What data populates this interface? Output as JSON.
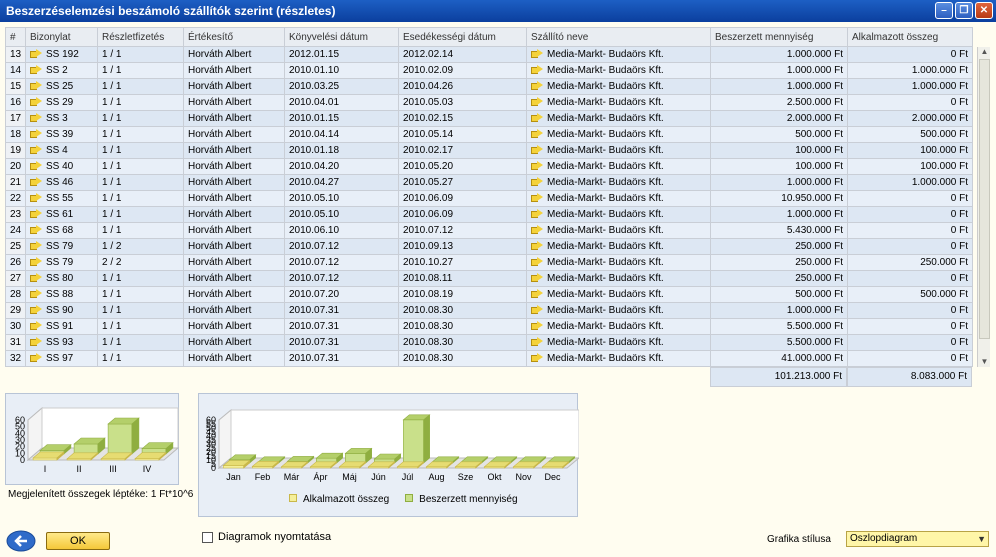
{
  "window": {
    "title": "Beszerzéselemzési beszámoló szállítók szerint (részletes)"
  },
  "columns": [
    "#",
    "Bizonylat",
    "Részletfizetés",
    "Értékesítő",
    "Könyvelési dátum",
    "Esedékességi dátum",
    "Szállító neve",
    "Beszerzett mennyiség",
    "Alkalmazott összeg"
  ],
  "rows": [
    [
      "13",
      "SS 192",
      "1 / 1",
      "Horváth Albert",
      "2012.01.15",
      "2012.02.14",
      "Media-Markt- Budaörs Kft.",
      "1.000.000 Ft",
      "0 Ft"
    ],
    [
      "14",
      "SS 2",
      "1 / 1",
      "Horváth Albert",
      "2010.01.10",
      "2010.02.09",
      "Media-Markt- Budaörs Kft.",
      "1.000.000 Ft",
      "1.000.000 Ft"
    ],
    [
      "15",
      "SS 25",
      "1 / 1",
      "Horváth Albert",
      "2010.03.25",
      "2010.04.26",
      "Media-Markt- Budaörs Kft.",
      "1.000.000 Ft",
      "1.000.000 Ft"
    ],
    [
      "16",
      "SS 29",
      "1 / 1",
      "Horváth Albert",
      "2010.04.01",
      "2010.05.03",
      "Media-Markt- Budaörs Kft.",
      "2.500.000 Ft",
      "0 Ft"
    ],
    [
      "17",
      "SS 3",
      "1 / 1",
      "Horváth Albert",
      "2010.01.15",
      "2010.02.15",
      "Media-Markt- Budaörs Kft.",
      "2.000.000 Ft",
      "2.000.000 Ft"
    ],
    [
      "18",
      "SS 39",
      "1 / 1",
      "Horváth Albert",
      "2010.04.14",
      "2010.05.14",
      "Media-Markt- Budaörs Kft.",
      "500.000 Ft",
      "500.000 Ft"
    ],
    [
      "19",
      "SS 4",
      "1 / 1",
      "Horváth Albert",
      "2010.01.18",
      "2010.02.17",
      "Media-Markt- Budaörs Kft.",
      "100.000 Ft",
      "100.000 Ft"
    ],
    [
      "20",
      "SS 40",
      "1 / 1",
      "Horváth Albert",
      "2010.04.20",
      "2010.05.20",
      "Media-Markt- Budaörs Kft.",
      "100.000 Ft",
      "100.000 Ft"
    ],
    [
      "21",
      "SS 46",
      "1 / 1",
      "Horváth Albert",
      "2010.04.27",
      "2010.05.27",
      "Media-Markt- Budaörs Kft.",
      "1.000.000 Ft",
      "1.000.000 Ft"
    ],
    [
      "22",
      "SS 55",
      "1 / 1",
      "Horváth Albert",
      "2010.05.10",
      "2010.06.09",
      "Media-Markt- Budaörs Kft.",
      "10.950.000 Ft",
      "0 Ft"
    ],
    [
      "23",
      "SS 61",
      "1 / 1",
      "Horváth Albert",
      "2010.05.10",
      "2010.06.09",
      "Media-Markt- Budaörs Kft.",
      "1.000.000 Ft",
      "0 Ft"
    ],
    [
      "24",
      "SS 68",
      "1 / 1",
      "Horváth Albert",
      "2010.06.10",
      "2010.07.12",
      "Media-Markt- Budaörs Kft.",
      "5.430.000 Ft",
      "0 Ft"
    ],
    [
      "25",
      "SS 79",
      "1 / 2",
      "Horváth Albert",
      "2010.07.12",
      "2010.09.13",
      "Media-Markt- Budaörs Kft.",
      "250.000 Ft",
      "0 Ft"
    ],
    [
      "26",
      "SS 79",
      "2 / 2",
      "Horváth Albert",
      "2010.07.12",
      "2010.10.27",
      "Media-Markt- Budaörs Kft.",
      "250.000 Ft",
      "250.000 Ft"
    ],
    [
      "27",
      "SS 80",
      "1 / 1",
      "Horváth Albert",
      "2010.07.12",
      "2010.08.11",
      "Media-Markt- Budaörs Kft.",
      "250.000 Ft",
      "0 Ft"
    ],
    [
      "28",
      "SS 88",
      "1 / 1",
      "Horváth Albert",
      "2010.07.20",
      "2010.08.19",
      "Media-Markt- Budaörs Kft.",
      "500.000 Ft",
      "500.000 Ft"
    ],
    [
      "29",
      "SS 90",
      "1 / 1",
      "Horváth Albert",
      "2010.07.31",
      "2010.08.30",
      "Media-Markt- Budaörs Kft.",
      "1.000.000 Ft",
      "0 Ft"
    ],
    [
      "30",
      "SS 91",
      "1 / 1",
      "Horváth Albert",
      "2010.07.31",
      "2010.08.30",
      "Media-Markt- Budaörs Kft.",
      "5.500.000 Ft",
      "0 Ft"
    ],
    [
      "31",
      "SS 93",
      "1 / 1",
      "Horváth Albert",
      "2010.07.31",
      "2010.08.30",
      "Media-Markt- Budaörs Kft.",
      "5.500.000 Ft",
      "0 Ft"
    ],
    [
      "32",
      "SS 97",
      "1 / 1",
      "Horváth Albert",
      "2010.07.31",
      "2010.08.30",
      "Media-Markt- Budaörs Kft.",
      "41.000.000 Ft",
      "0 Ft"
    ]
  ],
  "totals": {
    "quantity": "101.213.000 Ft",
    "applied": "8.083.000 Ft"
  },
  "scale_note": "Megjelenített összegek léptéke: 1 Ft*10^6",
  "buttons": {
    "ok": "OK"
  },
  "print_charts": {
    "label": "Diagramok nyomtatása",
    "checked": false
  },
  "chart_style": {
    "label": "Grafika stílusa",
    "value": "Oszlopdiagram"
  },
  "colors": {
    "applied": "#f5ef9a",
    "purchased": "#c9e08a"
  },
  "chart_data": [
    {
      "type": "bar",
      "categories": [
        "I",
        "II",
        "III",
        "IV"
      ],
      "series": [
        {
          "name": "Alkalmazott összeg",
          "values": [
            3,
            1,
            0,
            2
          ]
        },
        {
          "name": "Beszerzett mennyiség",
          "values": [
            5,
            15,
            45,
            8
          ]
        }
      ],
      "yticks": [
        "0",
        "10",
        "20",
        "30",
        "40",
        "50",
        "60"
      ],
      "ylim": [
        0,
        60
      ]
    },
    {
      "type": "bar",
      "categories": [
        "Jan",
        "Feb",
        "Már",
        "Ápr",
        "Máj",
        "Jún",
        "Júl",
        "Aug",
        "Sze",
        "Okt",
        "Nov",
        "Dec"
      ],
      "series": [
        {
          "name": "Alkalmazott összeg",
          "values": [
            3,
            2,
            0,
            1,
            0,
            0,
            0.75,
            0,
            0,
            0.25,
            0,
            1
          ]
        },
        {
          "name": "Beszerzett mennyiség",
          "values": [
            4,
            1,
            2,
            6,
            12,
            5,
            54,
            0,
            0,
            1,
            0,
            1
          ]
        }
      ],
      "yticks": [
        "0",
        "5",
        "10",
        "15",
        "20",
        "25",
        "30",
        "35",
        "40",
        "45",
        "50",
        "55",
        "60"
      ],
      "ylim": [
        0,
        60
      ],
      "legend": [
        "Alkalmazott összeg",
        "Beszerzett mennyiség"
      ]
    }
  ]
}
